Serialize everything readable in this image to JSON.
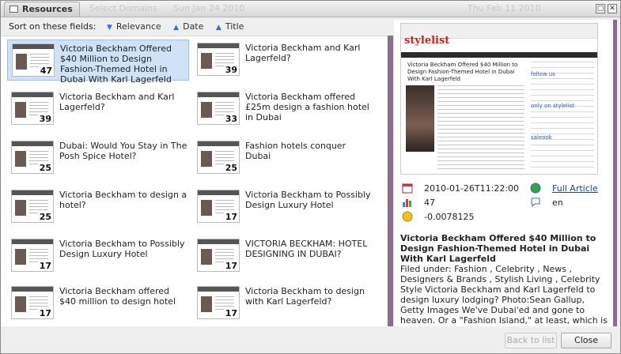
{
  "dialog": {
    "title": "Resources",
    "ghost_domains": "Select Domains",
    "ghost_date_left": "Sun Jan 24 2010",
    "ghost_date_right": "Thu Feb 11 2010"
  },
  "sort": {
    "label": "Sort on these fields:",
    "options": [
      "Relevance",
      "Date",
      "Title"
    ]
  },
  "items": [
    {
      "title": "Victoria Beckham Offered $40 Million to Design Fashion-Themed Hotel in Dubai With Karl Lagerfeld",
      "count": "47",
      "selected": true
    },
    {
      "title": "Victoria Beckham and Karl Lagerfeld?",
      "count": "39"
    },
    {
      "title": "Victoria Beckham and Karl Lagerfeld?",
      "count": "39"
    },
    {
      "title": "Victoria Beckham offered £25m design a fashion hotel in Dubai",
      "count": "33"
    },
    {
      "title": "Dubai: Would You Stay in The Posh Spice Hotel?",
      "count": "25"
    },
    {
      "title": "Fashion hotels conquer Dubai",
      "count": "25"
    },
    {
      "title": "Victoria Beckham to design a hotel?",
      "count": "25"
    },
    {
      "title": "Victoria Beckham to Possibly Design Luxury Hotel",
      "count": "17"
    },
    {
      "title": "Victoria Beckham to Possibly Design Luxury Hotel",
      "count": "17"
    },
    {
      "title": "VICTORIA BECKHAM: HOTEL DESIGNING IN DUBAI?",
      "count": "17"
    },
    {
      "title": "Victoria Beckham offered $40 million to design hotel",
      "count": "17"
    },
    {
      "title": "Victoria Beckham to design with Karl Lagerfeld?",
      "count": "17"
    }
  ],
  "preview": {
    "logo": "stylelist",
    "headline": "Victoria Beckham Offered $40 Million to Design Fashion-Themed Hotel in Dubai With Karl Lagerfeld",
    "side_follow": "follow us",
    "side_only": "only on stylelist",
    "side_sale": "saleook"
  },
  "detail": {
    "date": "2010-01-26T11:22:00",
    "count": "47",
    "score": "-0.0078125",
    "full_article": "Full Article",
    "lang": "en",
    "article_title": "Victoria Beckham Offered $40 Million to Design Fashion-Themed Hotel in Dubai With Karl Lagerfeld",
    "article_body": "Filed under: Fashion , Celebrity , News , Designers & Brands , Stylish Living , Celebrity Style Victoria Beckham and Karl Lagerfeld to design luxury lodging? Photo:Sean Gallup, Getty Images We've Dubai'ed and gone to heaven. Or a \"Fashion Island,\" at least, which is pretty much the same thing in our books. Word has it that Victoria Beckham was"
  },
  "footer": {
    "back": "Back to list",
    "close": "Close"
  },
  "colors": {
    "accent_purple": "#8e6c92",
    "selected_bg": "#cfe2f7",
    "link": "#1a3fb0"
  }
}
